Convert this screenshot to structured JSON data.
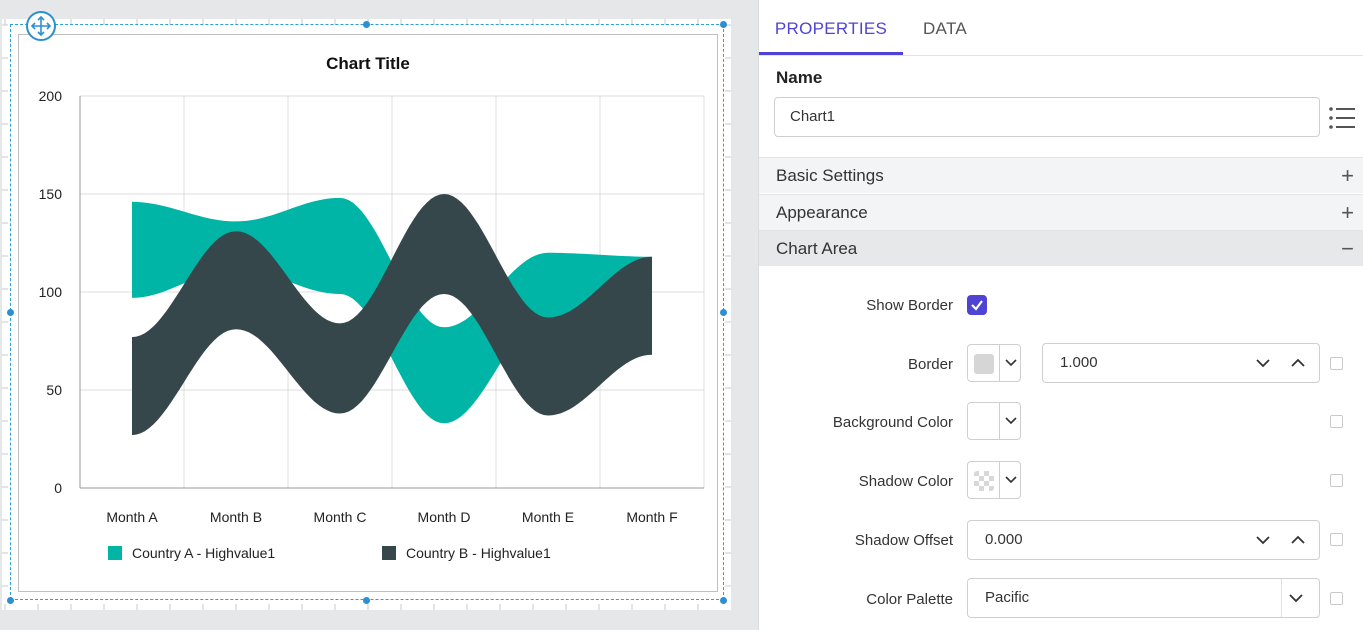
{
  "tabs": {
    "properties": "PROPERTIES",
    "data": "DATA"
  },
  "name_section": {
    "label": "Name",
    "value": "Chart1",
    "list_icon": "list-icon"
  },
  "sections": {
    "basic_settings": "Basic Settings",
    "appearance": "Appearance",
    "chart_area": "Chart Area",
    "expand_sign": "+",
    "collapse_sign": "−"
  },
  "chart_area": {
    "show_border_label": "Show Border",
    "show_border_checked": true,
    "border_label": "Border",
    "border_color": "#d6d6d6",
    "border_width": "1.000",
    "background_color_label": "Background Color",
    "background_color": "#ffffff",
    "shadow_color_label": "Shadow Color",
    "shadow_color": "transparent",
    "shadow_offset_label": "Shadow Offset",
    "shadow_offset": "0.000",
    "color_palette_label": "Color Palette",
    "color_palette": "Pacific"
  },
  "colors": {
    "accent": "#4f43d6",
    "selection": "#2d8fd0",
    "series_a": "#00b5a6",
    "series_b": "#36474b"
  },
  "chart_data": {
    "type": "area",
    "subtype": "range-area-spline",
    "title": "Chart Title",
    "categories": [
      "Month A",
      "Month B",
      "Month C",
      "Month D",
      "Month E",
      "Month F"
    ],
    "y_ticks": [
      "0",
      "50",
      "100",
      "150",
      "200"
    ],
    "ylim": [
      0,
      200
    ],
    "grid": true,
    "legend": "bottom",
    "series": [
      {
        "name": "Country A - Highvalue1",
        "high": [
          146,
          136,
          148,
          82,
          120,
          118
        ],
        "low": [
          97,
          112,
          99,
          33,
          87,
          68
        ],
        "color": "#00b5a6"
      },
      {
        "name": "Country B - Highvalue1",
        "high": [
          77,
          131,
          84,
          150,
          87,
          118
        ],
        "low": [
          27,
          81,
          38,
          99,
          37,
          68
        ],
        "color": "#36474b"
      }
    ]
  }
}
